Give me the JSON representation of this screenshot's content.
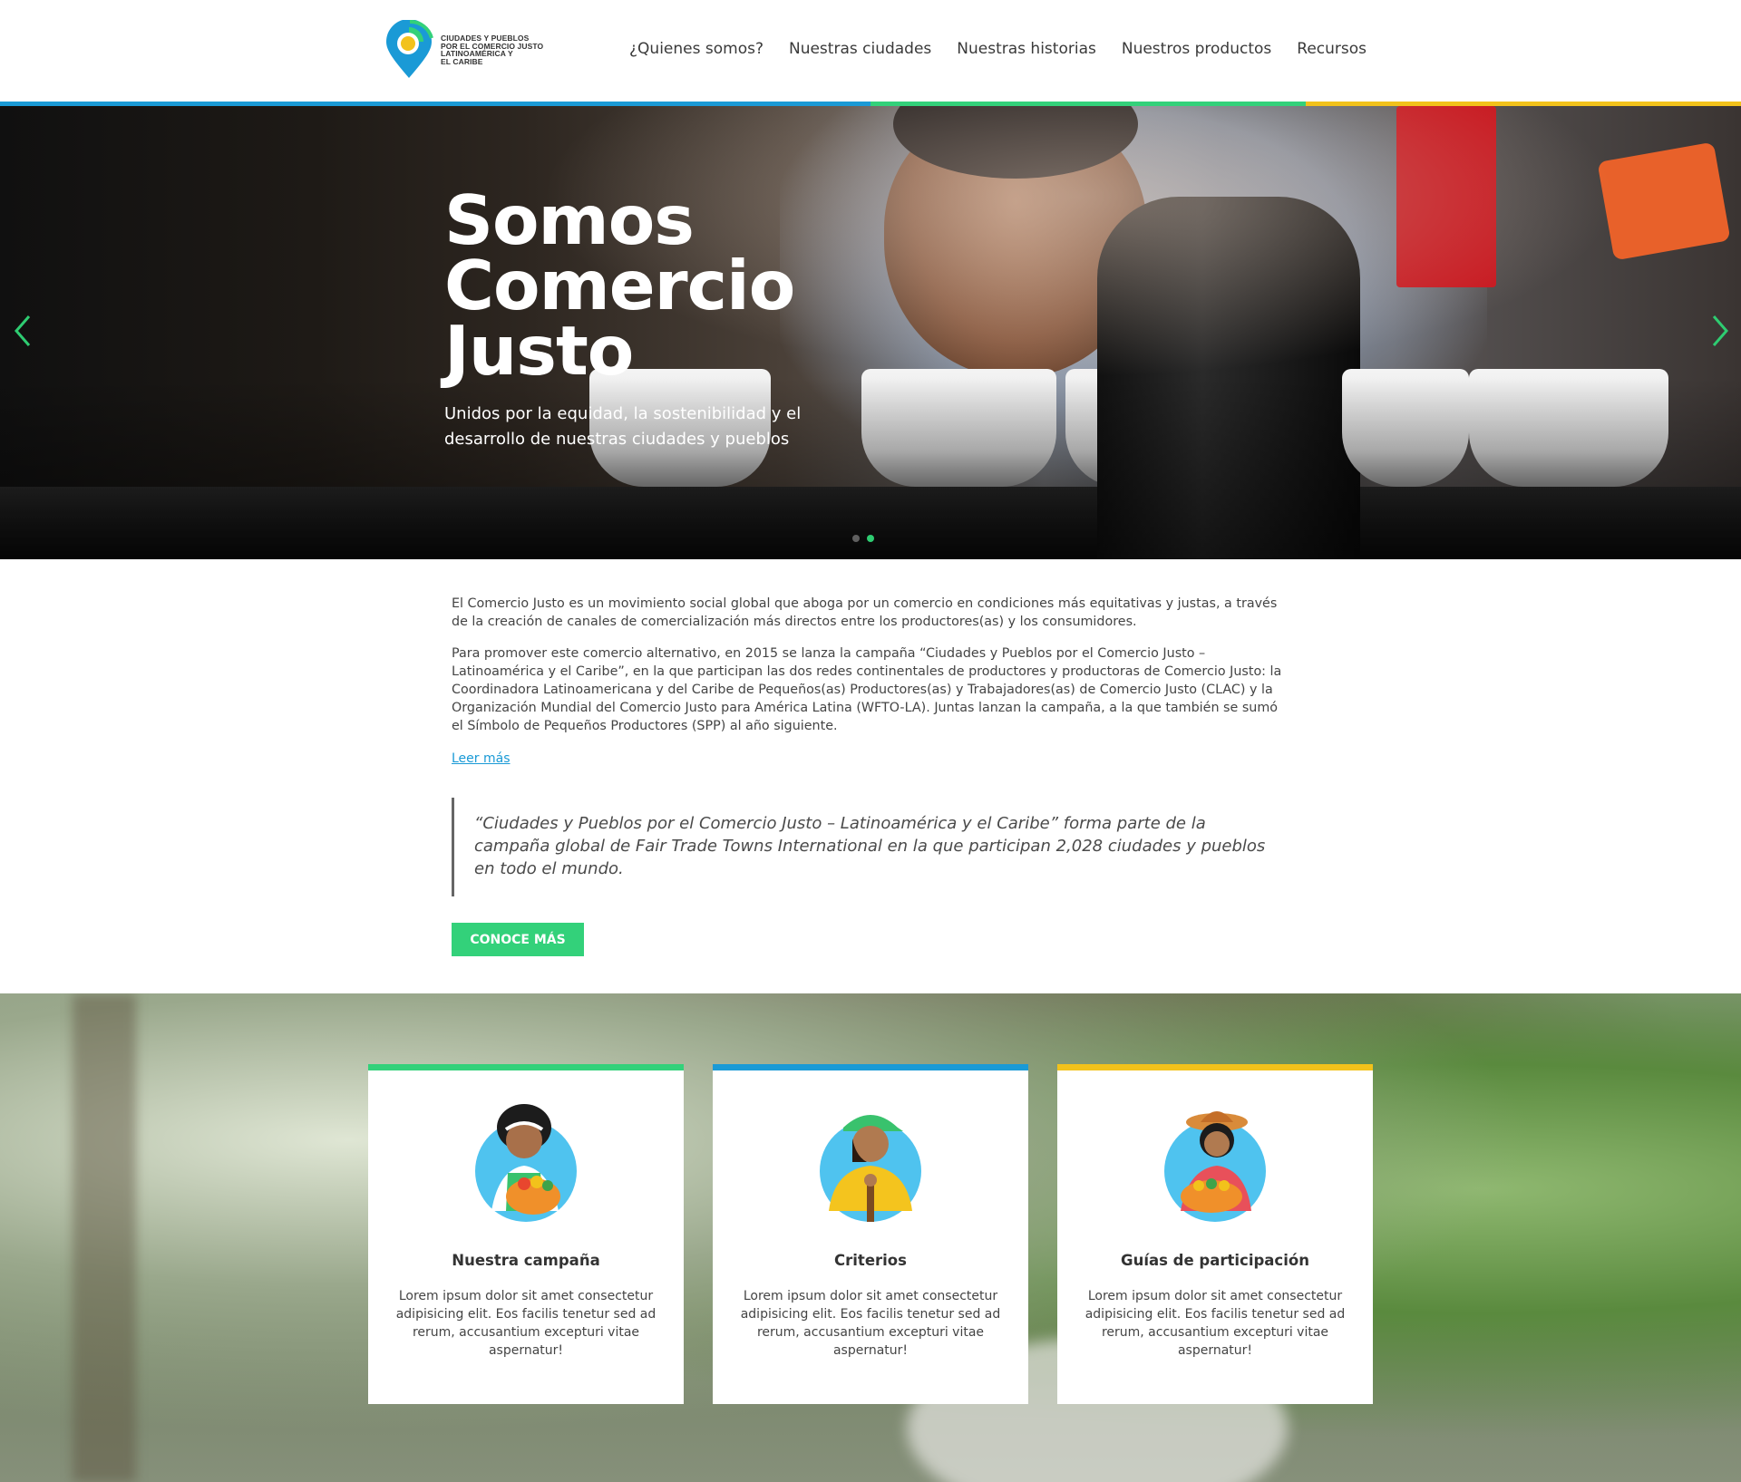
{
  "brand": {
    "logo_lines": [
      "CIUDADES Y PUEBLOS",
      "POR EL COMERCIO JUSTO",
      "LATINOAMÉRICA Y",
      "EL CARIBE"
    ],
    "colors": {
      "green": "#33d17a",
      "blue": "#1a9ad6",
      "yellow": "#f2c21b"
    }
  },
  "nav": {
    "items": [
      "¿Quienes somos?",
      "Nuestras ciudades",
      "Nuestras historias",
      "Nuestros productos",
      "Recursos"
    ]
  },
  "hero": {
    "title_lines": [
      "Somos",
      "Comercio",
      "Justo"
    ],
    "subtitle": "Unidos por la equidad, la sostenibilidad y el desarrollo de nuestras ciudades y pueblos",
    "prev_icon": "chevron-left-icon",
    "next_icon": "chevron-right-icon",
    "slide_count": 2,
    "active_slide": 2
  },
  "intro": {
    "paragraph1": "El Comercio Justo es un movimiento social global que aboga por un comercio en condiciones más equitativas y justas, a través de la creación de canales de comercialización más directos entre los productores(as) y los consumidores.",
    "paragraph2": "Para promover este comercio alternativo, en 2015 se lanza la campaña “Ciudades y Pueblos por el Comercio Justo – Latinoamérica y el Caribe”, en la que participan  las dos redes continentales de productores y productoras de Comercio Justo: la Coordinadora Latinoamericana y del Caribe de Pequeños(as) Productores(as) y Trabajadores(as) de Comercio Justo (CLAC) y la Organización Mundial del Comercio Justo para América Latina (WFTO-LA). Juntas lanzan la campaña, a la que también se sumó el Símbolo de Pequeños Productores (SPP) al año siguiente.",
    "read_more": "Leer más",
    "quote": "“Ciudades y Pueblos por el Comercio Justo – Latinoamérica y el Caribe” forma parte de la campaña global de Fair Trade Towns International en la que participan 2,028 ciudades y pueblos en todo el mundo.",
    "cta_label": "CONOCE MÁS"
  },
  "cards": [
    {
      "title": "Nuestra campaña",
      "text": "Lorem ipsum dolor sit amet consectetur adipisicing elit. Eos facilis tenetur sed ad rerum, accusantium excepturi vitae aspernatur!",
      "accent": "#33d17a",
      "icon": "woman-with-basket-icon"
    },
    {
      "title": "Criterios",
      "text": "Lorem ipsum dolor sit amet consectetur adipisicing elit. Eos facilis tenetur sed ad rerum, accusantium excepturi vitae aspernatur!",
      "accent": "#1a9ad6",
      "icon": "farmer-with-cap-icon"
    },
    {
      "title": "Guías de participación",
      "text": "Lorem ipsum dolor sit amet consectetur adipisicing elit. Eos facilis tenetur sed ad rerum, accusantium excepturi vitae aspernatur!",
      "accent": "#f2c21b",
      "icon": "woman-with-hat-icon"
    }
  ]
}
